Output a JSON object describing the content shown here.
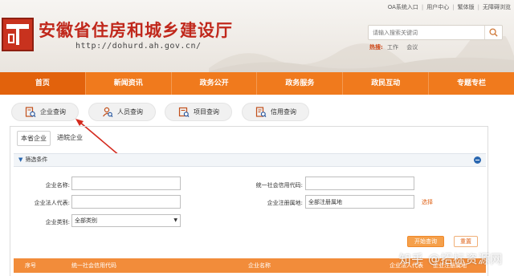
{
  "header": {
    "title": "安徽省住房和城乡建设厅",
    "url": "http://dohurd.ah.gov.cn/",
    "top_links": [
      "OA系统入口",
      "用户中心",
      "繁体版",
      "无障碍浏览"
    ],
    "search_placeholder": "请输入搜索关键词",
    "hot_label": "热搜:",
    "hot_words": [
      "工作",
      "会议"
    ]
  },
  "nav": {
    "items": [
      "首页",
      "新闻资讯",
      "政务公开",
      "政务服务",
      "政民互动",
      "专题专栏"
    ],
    "active": "首页"
  },
  "query_tabs": [
    "企业查询",
    "人员查询",
    "项目查询",
    "信用查询"
  ],
  "subtabs": [
    "本省企业",
    "进皖企业"
  ],
  "filter": {
    "title": "筛选条件",
    "company_name_label": "企业名称:",
    "credit_code_label": "统一社会信用代码:",
    "legal_rep_label": "企业法人代表:",
    "reg_location_label": "企业注册属地:",
    "reg_location_value": "全部注册属地",
    "select_link": "选择",
    "category_label": "企业类别:",
    "category_value": "全部类别",
    "search_btn": "开始查询",
    "reset_btn": "重置"
  },
  "table_headers": [
    "序号",
    "统一社会信用代码",
    "企业名称",
    "企业法人代表",
    "企业注册属地"
  ],
  "watermark": "知乎 @招标资源网",
  "colors": {
    "nav_bg": "#f07a1d",
    "title_red": "#c0281c",
    "accent_orange": "#e0641a"
  }
}
